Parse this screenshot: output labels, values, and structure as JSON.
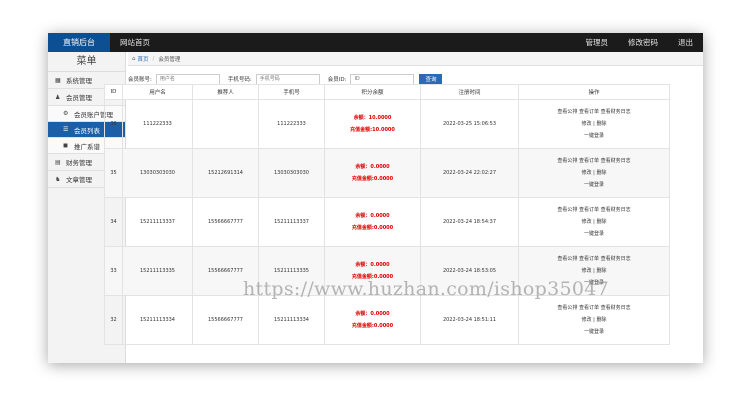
{
  "topbar": {
    "brand": "直销后台",
    "site_home": "网站首页",
    "admin": "管理员",
    "change_password": "修改密码",
    "logout": "退出"
  },
  "sidebar": {
    "title": "菜单",
    "items": [
      {
        "label": "系统管理",
        "icon": "settings-icon"
      },
      {
        "label": "会员管理",
        "icon": "user-icon"
      },
      {
        "label": "会员账户管理",
        "icon": "account-icon"
      },
      {
        "label": "会员列表",
        "icon": "list-icon"
      },
      {
        "label": "推广系谱",
        "icon": "tree-icon"
      },
      {
        "label": "财务管理",
        "icon": "finance-icon"
      },
      {
        "label": "文章管理",
        "icon": "article-icon"
      }
    ]
  },
  "breadcrumb": {
    "home": "首页",
    "current": "会员管理"
  },
  "filter": {
    "account_label": "会员账号:",
    "account_placeholder": "用户名",
    "phone_label": "手机号码:",
    "phone_placeholder": "手机号码",
    "id_label": "会员ID:",
    "id_placeholder": "ID",
    "query": "查询"
  },
  "table": {
    "headers": [
      "ID",
      "用户名",
      "推荐人",
      "手机号",
      "积分余额",
      "注册时间",
      "操作"
    ],
    "rows": [
      {
        "id": "36",
        "username": "111222333",
        "referrer": "",
        "phone": "111222333",
        "balance": "余额：10.0000",
        "recharge": "充值金额:10.0000",
        "time": "2022-03-25 15:06:53"
      },
      {
        "id": "35",
        "username": "13030303030",
        "referrer": "15212691314",
        "phone": "13030303030",
        "balance": "余额：0.0000",
        "recharge": "充值金额:0.0000",
        "time": "2022-03-24 22:02:27"
      },
      {
        "id": "34",
        "username": "15211113337",
        "referrer": "15566667777",
        "phone": "15211113337",
        "balance": "余额：0.0000",
        "recharge": "充值金额:0.0000",
        "time": "2022-03-24 18:54:37"
      },
      {
        "id": "33",
        "username": "15211113335",
        "referrer": "15566667777",
        "phone": "15211113335",
        "balance": "余额：0.0000",
        "recharge": "充值金额:0.0000",
        "time": "2022-03-24 18:53:05"
      },
      {
        "id": "32",
        "username": "15211113334",
        "referrer": "15566667777",
        "phone": "15211113334",
        "balance": "余额：0.0000",
        "recharge": "充值金额:0.0000",
        "time": "2022-03-24 18:51:11"
      }
    ],
    "ops": {
      "view_orders": "查看公排",
      "view_stock": "查看订单",
      "view_finance": "查看财务日志",
      "edit": "修改",
      "delete": "删除",
      "login": "一键登录"
    }
  },
  "watermark": "https://www.huzhan.com/ishop35047"
}
